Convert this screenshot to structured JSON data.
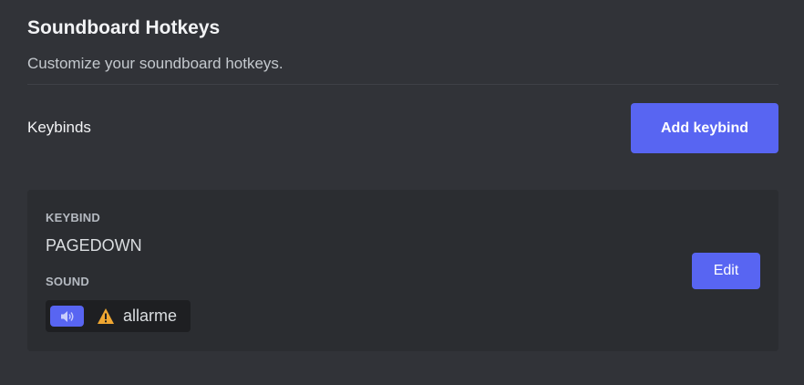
{
  "header": {
    "title": "Soundboard Hotkeys",
    "subtitle": "Customize your soundboard hotkeys."
  },
  "keybinds_section": {
    "label": "Keybinds",
    "add_button_label": "Add keybind"
  },
  "keybind_entry": {
    "keybind_label": "KEYBIND",
    "keybind_value": "PAGEDOWN",
    "sound_label": "SOUND",
    "sound_name": "allarme",
    "sound_icon": "speaker-icon",
    "warning_icon": "warning-icon",
    "edit_button_label": "Edit"
  },
  "colors": {
    "background": "#313338",
    "card": "#2b2d31",
    "accent": "#5865f2",
    "warning": "#f0a732"
  }
}
